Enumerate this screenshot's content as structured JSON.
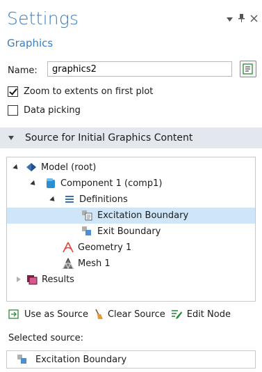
{
  "header": {
    "title": "Settings",
    "subtitle": "Graphics",
    "controls": [
      "chevron-down-icon",
      "pin-icon",
      "close-icon"
    ]
  },
  "name_field": {
    "label": "Name:",
    "value": "graphics2"
  },
  "checkboxes": [
    {
      "label": "Zoom to extents on first plot",
      "checked": true
    },
    {
      "label": "Data picking",
      "checked": false
    }
  ],
  "section": {
    "label": "Source for Initial Graphics Content"
  },
  "tree": [
    {
      "label": "Model (root)",
      "icon": "model-root-icon",
      "state": "open",
      "selected": false
    },
    {
      "label": "Component 1 (comp1)",
      "icon": "component-icon",
      "state": "open",
      "selected": false
    },
    {
      "label": "Definitions",
      "icon": "definitions-icon",
      "state": "open",
      "selected": false
    },
    {
      "label": "Excitation Boundary",
      "icon": "selection-icon",
      "state": "leaf",
      "selected": true
    },
    {
      "label": "Exit Boundary",
      "icon": "selection-icon",
      "state": "leaf",
      "selected": false
    },
    {
      "label": "Geometry 1",
      "icon": "geometry-icon",
      "state": "leaf",
      "selected": false
    },
    {
      "label": "Mesh 1",
      "icon": "mesh-icon",
      "state": "leaf",
      "selected": false
    },
    {
      "label": "Results",
      "icon": "results-icon",
      "state": "closed",
      "selected": false
    }
  ],
  "toolbar": {
    "use_as_source": "Use as Source",
    "clear_source": "Clear Source",
    "edit_node": "Edit Node"
  },
  "selected_source": {
    "label": "Selected source:",
    "value": "Excitation Boundary"
  },
  "colors": {
    "title": "#3a7fc1",
    "section_bg": "#e3e8ee",
    "selection_bg": "#cfe5f8"
  }
}
